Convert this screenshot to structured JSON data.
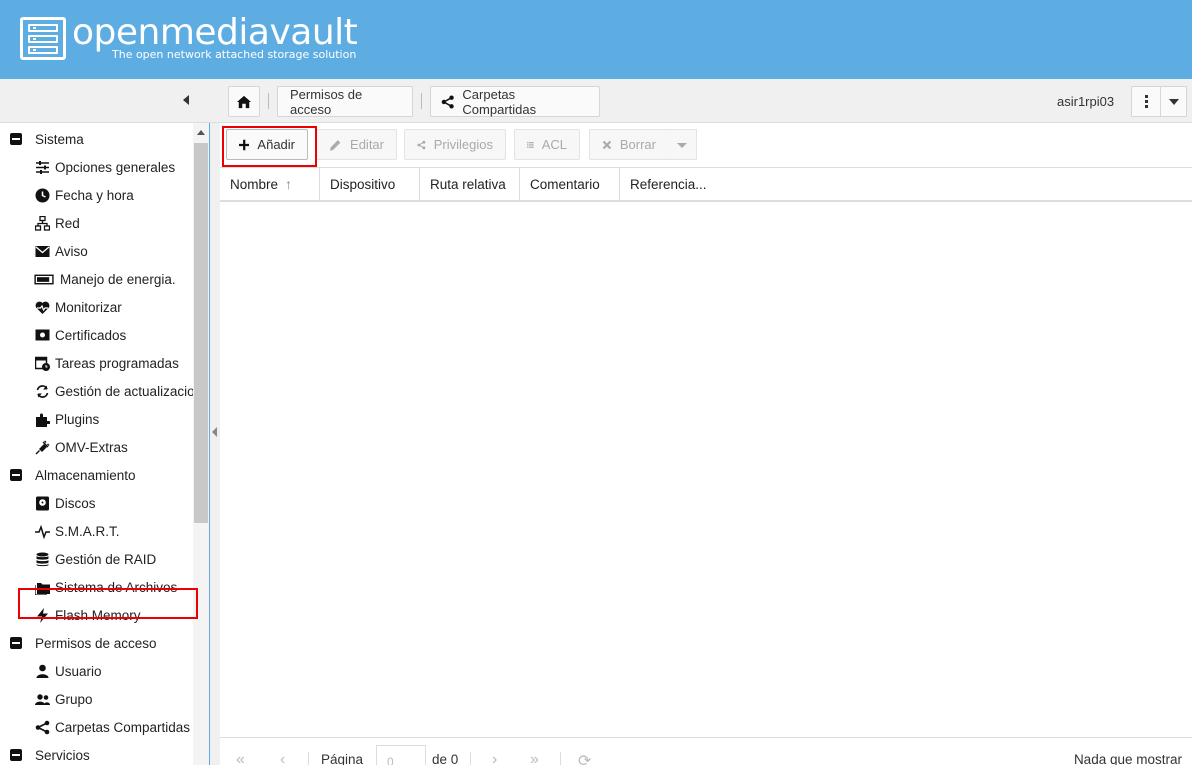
{
  "header": {
    "brand": "openmediavault",
    "tagline": "The open network attached storage solution"
  },
  "breadcrumb": {
    "section": "Permisos de acceso",
    "page": "Carpetas Compartidas"
  },
  "user": "asir1rpi03",
  "sidebar": {
    "groups": [
      {
        "label": "Sistema",
        "items": [
          {
            "label": "Opciones generales",
            "icon": "sliders-icon"
          },
          {
            "label": "Fecha y hora",
            "icon": "clock-icon"
          },
          {
            "label": "Red",
            "icon": "network-icon"
          },
          {
            "label": "Aviso",
            "icon": "envelope-icon"
          },
          {
            "label": "Manejo de energia.",
            "icon": "battery-icon"
          },
          {
            "label": "Monitorizar",
            "icon": "heartbeat-icon"
          },
          {
            "label": "Certificados",
            "icon": "certificate-icon"
          },
          {
            "label": "Tareas programadas",
            "icon": "calendar-clock-icon"
          },
          {
            "label": "Gestión de actualizacio",
            "icon": "refresh-icon"
          },
          {
            "label": "Plugins",
            "icon": "puzzle-icon"
          },
          {
            "label": "OMV-Extras",
            "icon": "plug-icon"
          }
        ]
      },
      {
        "label": "Almacenamiento",
        "items": [
          {
            "label": "Discos",
            "icon": "disk-icon"
          },
          {
            "label": "S.M.A.R.T.",
            "icon": "pulse-icon"
          },
          {
            "label": "Gestión de RAID",
            "icon": "database-icon"
          },
          {
            "label": "Sistema de Archivos",
            "icon": "folders-icon"
          },
          {
            "label": "Flash Memory",
            "icon": "flash-icon"
          }
        ]
      },
      {
        "label": "Permisos de acceso",
        "items": [
          {
            "label": "Usuario",
            "icon": "user-icon"
          },
          {
            "label": "Grupo",
            "icon": "group-icon"
          },
          {
            "label": "Carpetas Compartidas",
            "icon": "share-icon"
          }
        ]
      },
      {
        "label": "Servicios",
        "items": []
      }
    ]
  },
  "toolbar": {
    "add": "Añadir",
    "edit": "Editar",
    "privileges": "Privilegios",
    "acl": "ACL",
    "delete": "Borrar"
  },
  "grid": {
    "columns": [
      "Nombre",
      "Dispositivo",
      "Ruta relativa",
      "Comentario",
      "Referencia..."
    ],
    "sort_indicator": "↑"
  },
  "pager": {
    "page_label": "Página",
    "page_value": "0",
    "of_label": "de 0",
    "empty_text": "Nada que mostrar"
  }
}
